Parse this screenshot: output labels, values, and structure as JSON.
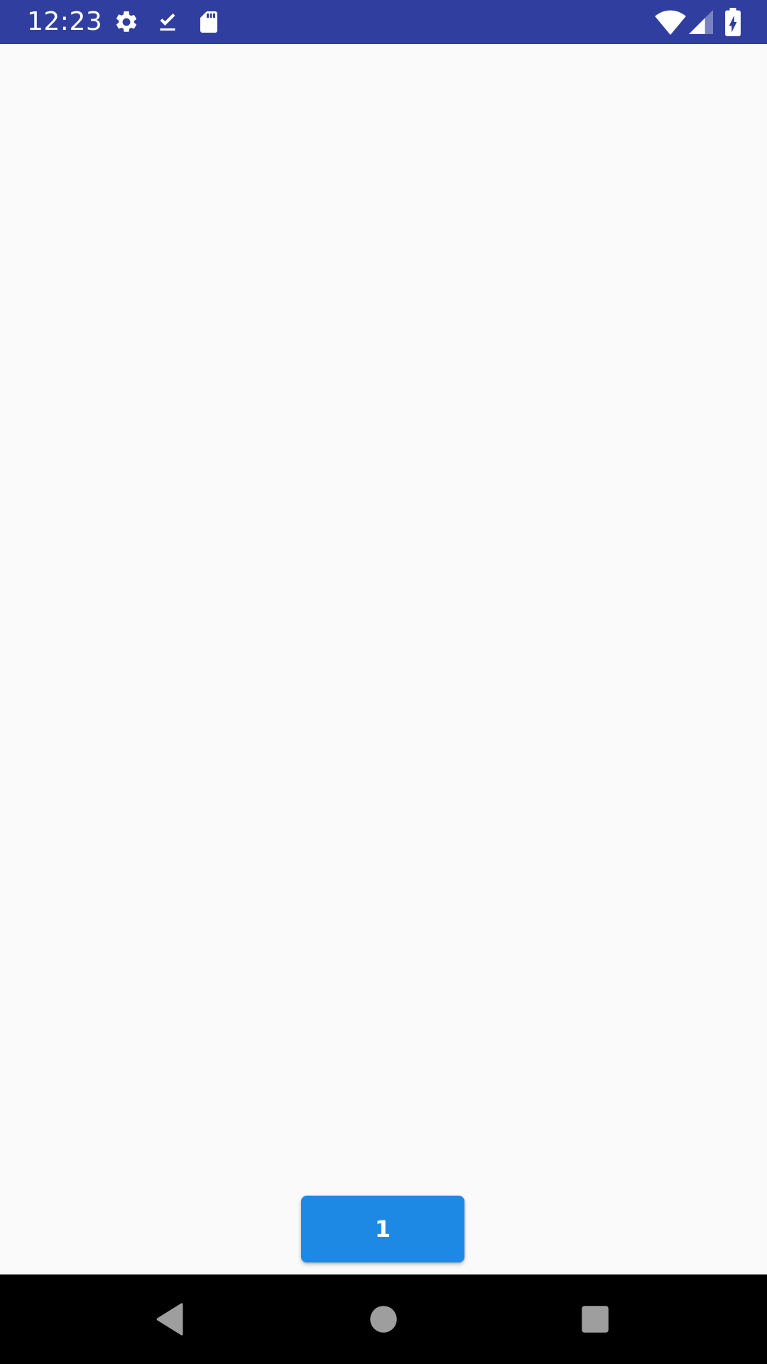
{
  "status_bar": {
    "time": "12:23",
    "background_color": "#303f9f",
    "left_icons": [
      "gear-icon",
      "download-done-icon",
      "sd-card-icon"
    ],
    "right_icons": [
      "wifi-icon",
      "cell-signal-icon",
      "battery-charging-icon"
    ]
  },
  "main": {
    "background_color": "#fafafa",
    "button": {
      "label": "1",
      "color": "#1e88e5"
    }
  },
  "nav_bar": {
    "background_color": "#000000",
    "buttons": [
      "back-icon",
      "home-icon",
      "recents-icon"
    ]
  }
}
